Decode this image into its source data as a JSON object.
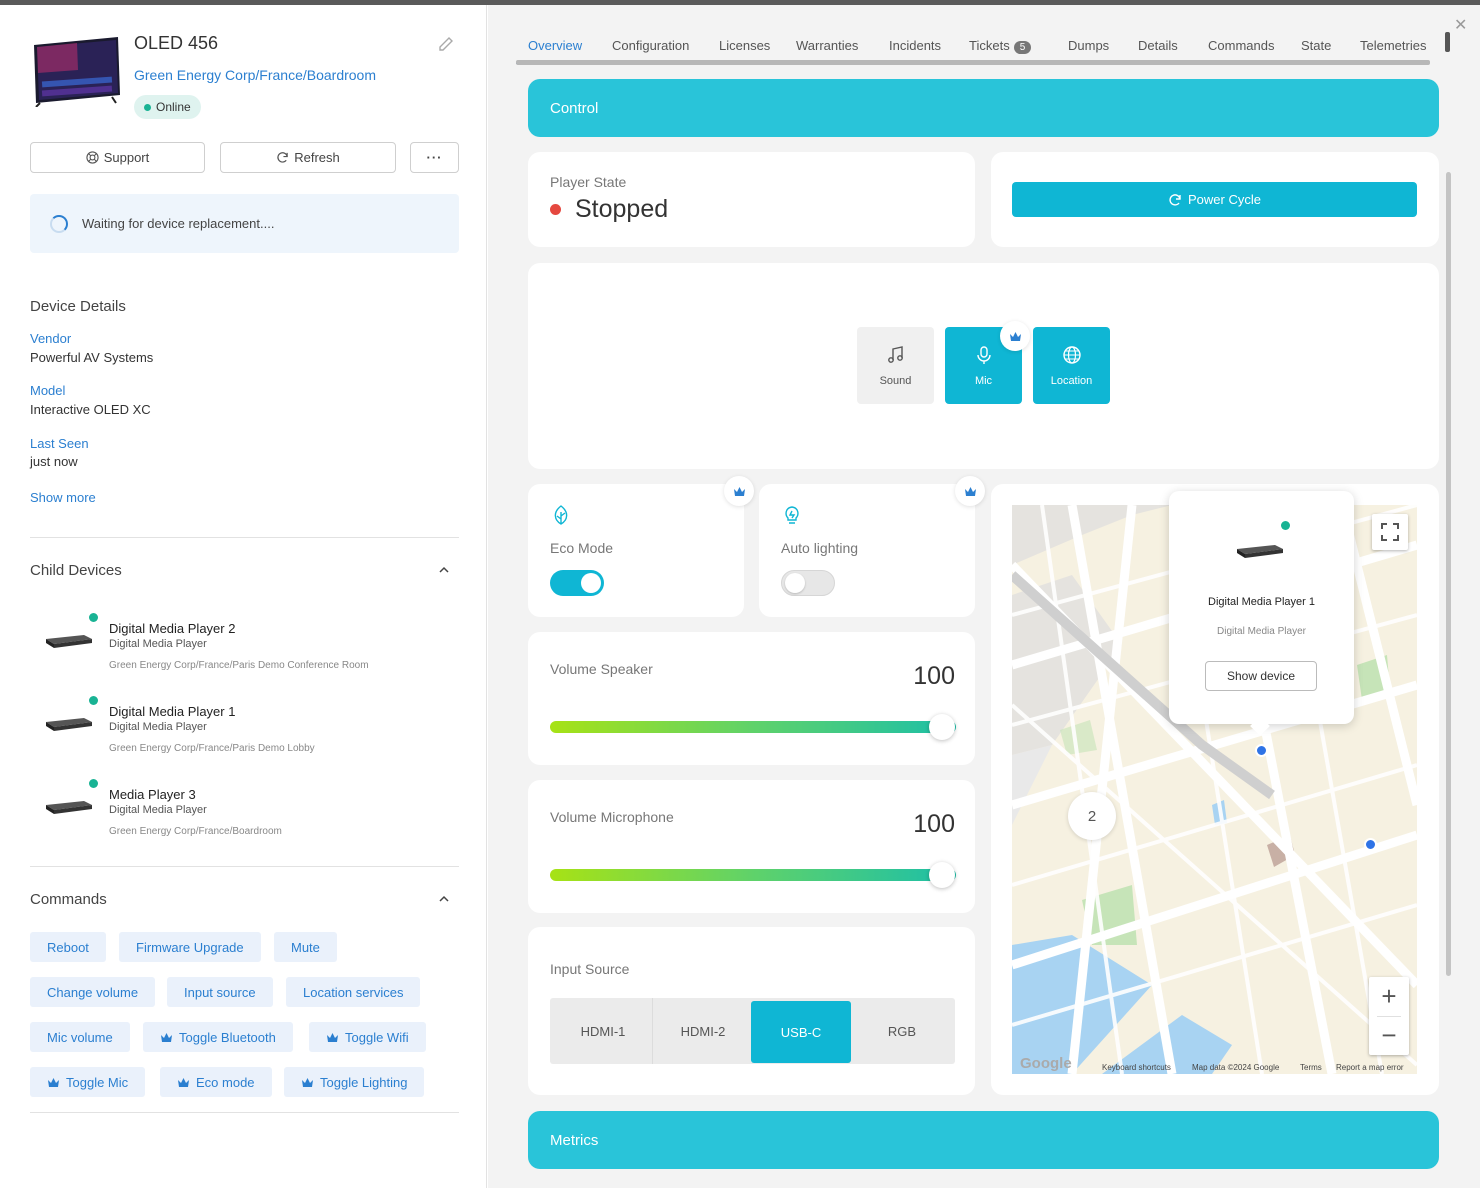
{
  "device": {
    "title": "OLED 456",
    "path": "Green Energy Corp/France/Boardroom",
    "status": "Online"
  },
  "actions": {
    "support": "Support",
    "refresh": "Refresh",
    "more": "···"
  },
  "notice": "Waiting for device replacement....",
  "details": {
    "title": "Device Details",
    "vendor_label": "Vendor",
    "vendor": "Powerful AV Systems",
    "model_label": "Model",
    "model": "Interactive OLED XC",
    "last_seen_label": "Last Seen",
    "last_seen": "just now",
    "show_more": "Show more"
  },
  "child_devices": {
    "title": "Child Devices",
    "items": [
      {
        "name": "Digital Media Player 2",
        "type": "Digital Media Player",
        "location": "Green Energy Corp/France/Paris Demo Conference Room"
      },
      {
        "name": "Digital Media Player 1",
        "type": "Digital Media Player",
        "location": "Green Energy Corp/France/Paris Demo Lobby"
      },
      {
        "name": "Media Player 3",
        "type": "Digital Media Player",
        "location": "Green Energy Corp/France/Boardroom"
      }
    ]
  },
  "commands": {
    "title": "Commands",
    "items": [
      {
        "label": "Reboot",
        "premium": false
      },
      {
        "label": "Firmware Upgrade",
        "premium": false
      },
      {
        "label": "Mute",
        "premium": false
      },
      {
        "label": "Change volume",
        "premium": false
      },
      {
        "label": "Input source",
        "premium": false
      },
      {
        "label": "Location services",
        "premium": false
      },
      {
        "label": "Mic volume",
        "premium": false
      },
      {
        "label": "Toggle Bluetooth",
        "premium": true
      },
      {
        "label": "Toggle Wifi",
        "premium": true
      },
      {
        "label": "Toggle Mic",
        "premium": true
      },
      {
        "label": "Eco mode",
        "premium": true
      },
      {
        "label": "Toggle Lighting",
        "premium": true
      }
    ]
  },
  "tabs": {
    "active": "Overview",
    "items": [
      "Overview",
      "Configuration",
      "Licenses",
      "Warranties",
      "Incidents",
      "Tickets",
      "Dumps",
      "Details",
      "Commands",
      "State",
      "Telemetries"
    ],
    "tickets_badge": "5"
  },
  "control": {
    "banner": "Control",
    "player_state_label": "Player State",
    "player_state": "Stopped",
    "power_cycle": "Power Cycle",
    "features": [
      {
        "label": "Sound",
        "icon": "music-note-icon",
        "active": false
      },
      {
        "label": "Mic",
        "icon": "microphone-icon",
        "active": true
      },
      {
        "label": "Location",
        "icon": "globe-icon",
        "active": true
      }
    ],
    "eco_mode_label": "Eco Mode",
    "eco_mode_on": true,
    "auto_lighting_label": "Auto lighting",
    "auto_lighting_on": false,
    "volume_speaker_label": "Volume Speaker",
    "volume_speaker": "100",
    "volume_microphone_label": "Volume Microphone",
    "volume_microphone": "100",
    "input_source_label": "Input Source",
    "input_sources": [
      "HDMI-1",
      "HDMI-2",
      "USB-C",
      "RGB"
    ],
    "input_source_selected": "USB-C"
  },
  "map": {
    "popup_name": "Digital Media Player 1",
    "popup_type": "Digital Media Player",
    "popup_button": "Show device",
    "cluster_count": "2",
    "keyboard_shortcuts": "Keyboard shortcuts",
    "map_data": "Map data ©2024 Google",
    "terms": "Terms",
    "report": "Report a map error",
    "google": "Google"
  },
  "metrics": {
    "banner": "Metrics"
  },
  "colors": {
    "accent": "#29c4d9",
    "primary": "#0fb6d4",
    "link": "#2b7fd0",
    "online": "#19b394",
    "stopped": "#e5483f"
  }
}
